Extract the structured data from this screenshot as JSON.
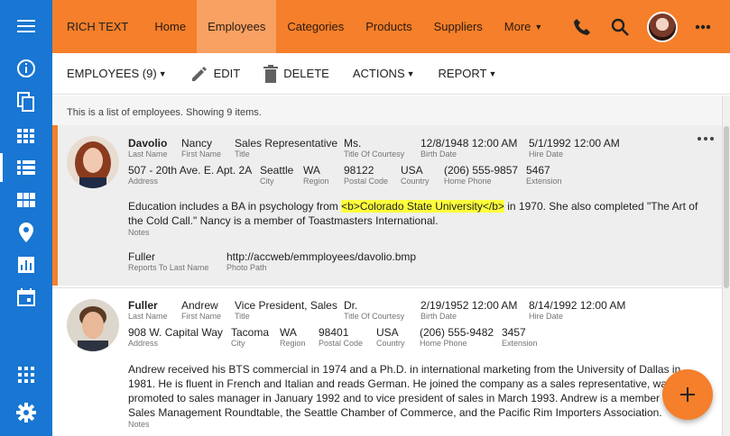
{
  "rail": {
    "items": [
      {
        "name": "menu-icon"
      },
      {
        "name": "info-icon"
      },
      {
        "name": "copy-icon"
      },
      {
        "name": "grid-icon"
      },
      {
        "name": "list-icon"
      },
      {
        "name": "table-icon"
      },
      {
        "name": "location-icon"
      },
      {
        "name": "chart-icon"
      },
      {
        "name": "calendar-icon"
      },
      {
        "name": "apps-icon"
      },
      {
        "name": "settings-icon"
      }
    ]
  },
  "topbar": {
    "brand": "RICH TEXT",
    "nav": [
      "Home",
      "Employees",
      "Categories",
      "Products",
      "Suppliers"
    ],
    "more": "More",
    "active": "Employees"
  },
  "toolbar": {
    "employees": "EMPLOYEES (9)",
    "edit": "EDIT",
    "delete": "DELETE",
    "actions": "ACTIONS",
    "report": "REPORT"
  },
  "info": "This is a list of employees. Showing 9 items.",
  "labels": {
    "last_name": "Last Name",
    "first_name": "First Name",
    "title": "Title",
    "title_of_courtesy": "Title Of Courtesy",
    "birth_date": "Birth Date",
    "hire_date": "Hire Date",
    "address": "Address",
    "city": "City",
    "region": "Region",
    "postal_code": "Postal Code",
    "country": "Country",
    "home_phone": "Home Phone",
    "extension": "Extension",
    "notes": "Notes",
    "reports_to": "Reports To Last Name",
    "photo_path": "Photo Path"
  },
  "employees": [
    {
      "last_name": "Davolio",
      "first_name": "Nancy",
      "title": "Sales Representative",
      "title_of_courtesy": "Ms.",
      "birth_date": "12/8/1948 12:00 AM",
      "hire_date": "5/1/1992 12:00 AM",
      "address": "507 - 20th Ave. E. Apt. 2A",
      "city": "Seattle",
      "region": "WA",
      "postal_code": "98122",
      "country": "USA",
      "home_phone": "(206) 555-9857",
      "extension": "5467",
      "notes_pre": "Education includes a BA in psychology from ",
      "notes_hl": "<b>Colorado State University</b>",
      "notes_post": " in 1970. She also completed \"The Art of the Cold Call.\" Nancy is a member of Toastmasters International.",
      "reports_to": "Fuller",
      "photo_path": "http://accweb/emmployees/davolio.bmp"
    },
    {
      "last_name": "Fuller",
      "first_name": "Andrew",
      "title": "Vice President, Sales",
      "title_of_courtesy": "Dr.",
      "birth_date": "2/19/1952 12:00 AM",
      "hire_date": "8/14/1992 12:00 AM",
      "address": "908 W. Capital Way",
      "city": "Tacoma",
      "region": "WA",
      "postal_code": "98401",
      "country": "USA",
      "home_phone": "(206) 555-9482",
      "extension": "3457",
      "notes": "Andrew received his BTS commercial in 1974 and a Ph.D. in international marketing from the University of Dallas in 1981. He is fluent in French and Italian and reads German. He joined the company as a sales representative, was promoted to sales manager in January 1992 and to vice president of sales in March 1993. Andrew is a member of the Sales Management Roundtable, the Seattle Chamber of Commerce, and the Pacific Rim Importers Association."
    }
  ],
  "colors": {
    "rail": "#1976d2",
    "topbar": "#f57f2a",
    "highlight": "#ffff3b"
  }
}
